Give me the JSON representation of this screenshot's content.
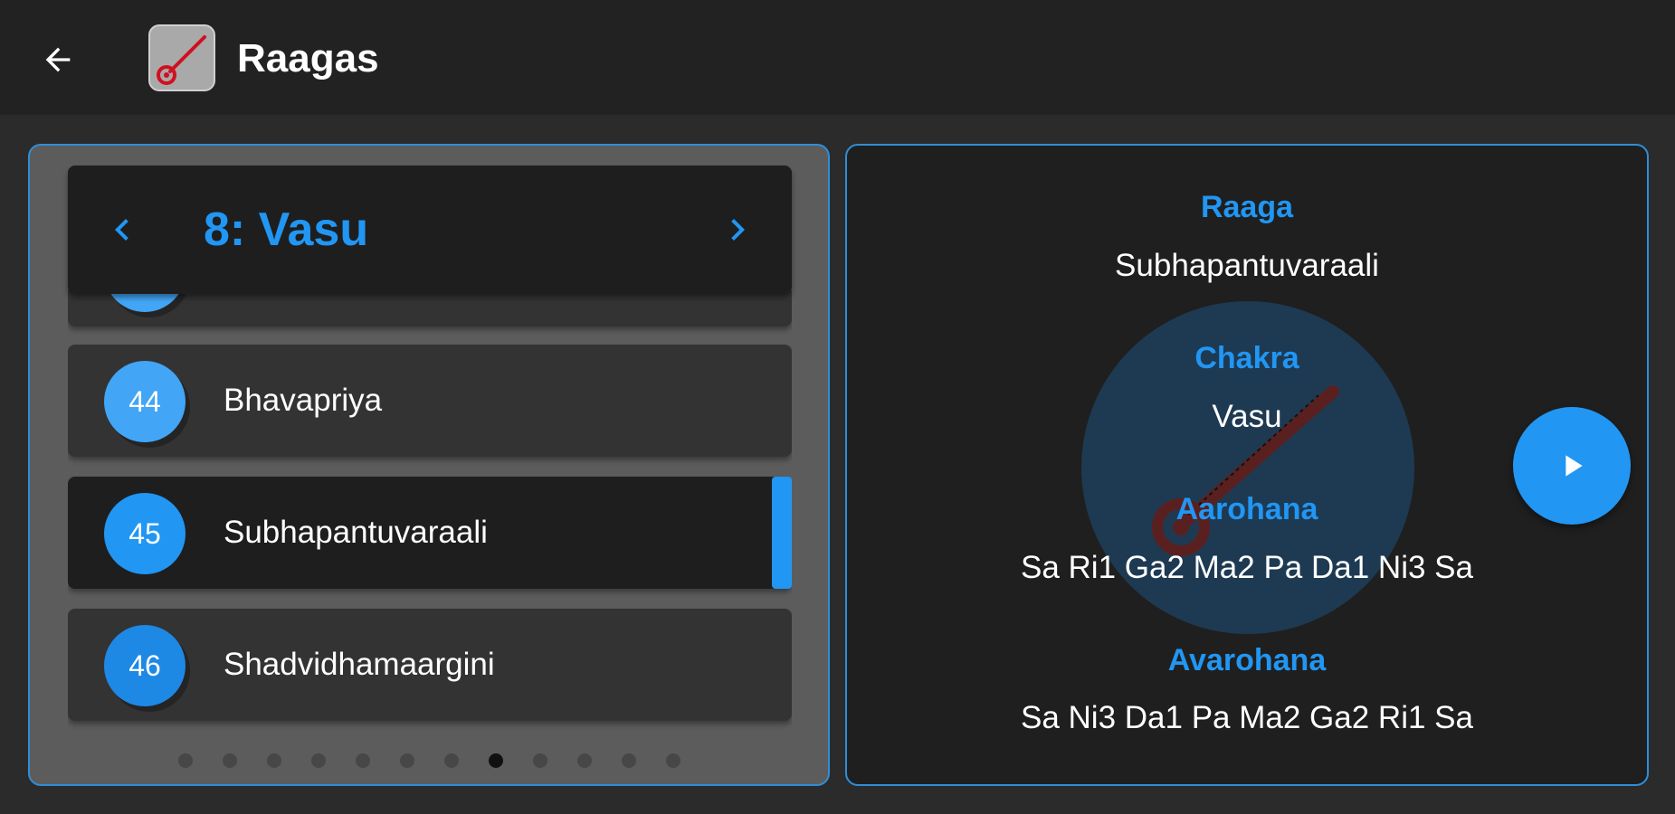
{
  "appbar": {
    "title": "Raagas",
    "back_icon": "arrow-left-icon",
    "logo_icon": "veena-icon"
  },
  "chakra_nav": {
    "title": "8: Vasu",
    "prev_icon": "chevron-left-icon",
    "next_icon": "chevron-right-icon"
  },
  "raaga_list": [
    {
      "number": "44",
      "name": "Bhavapriya",
      "selected": false
    },
    {
      "number": "45",
      "name": "Subhapantuvaraali",
      "selected": true
    },
    {
      "number": "46",
      "name": "Shadvidhamaargini",
      "selected": false
    }
  ],
  "pager": {
    "count": 12,
    "active_index": 7
  },
  "details": {
    "raaga_label": "Raaga",
    "raaga_value": "Subhapantuvaraali",
    "chakra_label": "Chakra",
    "chakra_value": "Vasu",
    "aarohana_label": "Aarohana",
    "aarohana_value": "Sa Ri1 Ga2 Ma2 Pa Da1 Ni3 Sa",
    "avarohana_label": "Avarohana",
    "avarohana_value": "Sa Ni3 Da1 Pa Ma2 Ga2  Ri1 Sa"
  },
  "play_icon": "play-icon",
  "colors": {
    "accent": "#2196f3",
    "appbar_bg": "#222222",
    "page_bg": "#2b2b2b",
    "card_border": "#2f8ed8"
  }
}
